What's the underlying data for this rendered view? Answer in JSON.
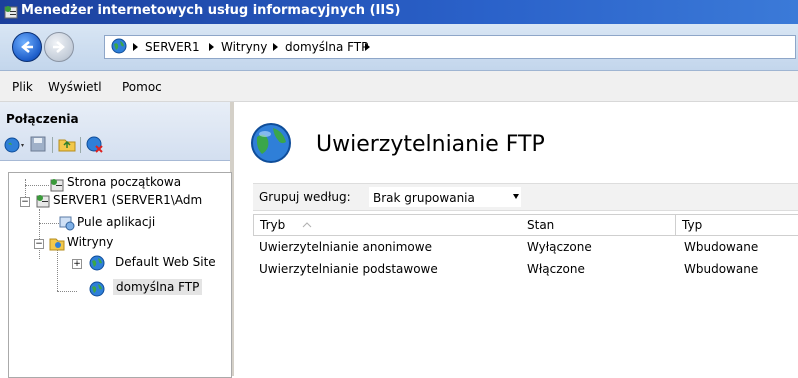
{
  "window": {
    "title": "Menedżer internetowych usług informacyjnych (IIS)"
  },
  "address": {
    "crumbs": [
      "SERVER1",
      "Witryny",
      "domyślna FTP"
    ]
  },
  "menu": {
    "items": [
      "Plik",
      "Wyświetl",
      "Pomoc"
    ]
  },
  "connections": {
    "title": "Połączenia",
    "tree": [
      {
        "label": "Strona początkowa"
      },
      {
        "label": "SERVER1 (SERVER1\\Adm"
      },
      {
        "label": "Pule aplikacji"
      },
      {
        "label": "Witryny"
      },
      {
        "label": "Default Web Site"
      },
      {
        "label": "domyślna FTP"
      }
    ]
  },
  "main": {
    "title": "Uwierzytelnianie FTP",
    "group_label": "Grupuj według:",
    "group_value": "Brak grupowania",
    "columns": [
      "Tryb",
      "Stan",
      "Typ"
    ],
    "rows": [
      {
        "mode": "Uwierzytelnianie anonimowe",
        "state": "Wyłączone",
        "type": "Wbudowane"
      },
      {
        "mode": "Uwierzytelnianie podstawowe",
        "state": "Włączone",
        "type": "Wbudowane"
      }
    ]
  },
  "colors": {
    "titlebar": "#2a61c9",
    "accent": "#1d5dc9"
  }
}
